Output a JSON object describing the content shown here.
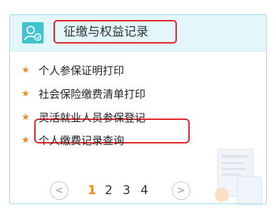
{
  "header": {
    "icon": "user-icon",
    "title": "征缴与权益记录"
  },
  "list": {
    "bullet_color": "#f08a1a",
    "items": [
      {
        "label": "个人参保证明打印"
      },
      {
        "label": "社会保险缴费清单打印"
      },
      {
        "label": "灵活就业人员参保登记"
      },
      {
        "label": "个人缴费记录查询"
      }
    ]
  },
  "pager": {
    "prev": "<",
    "next": ">",
    "pages": [
      "1",
      "2",
      "3",
      "4"
    ],
    "current": "1"
  },
  "colors": {
    "accent": "#3fc4cf",
    "highlight_border": "#e2262f",
    "active_page": "#f08a1a"
  }
}
